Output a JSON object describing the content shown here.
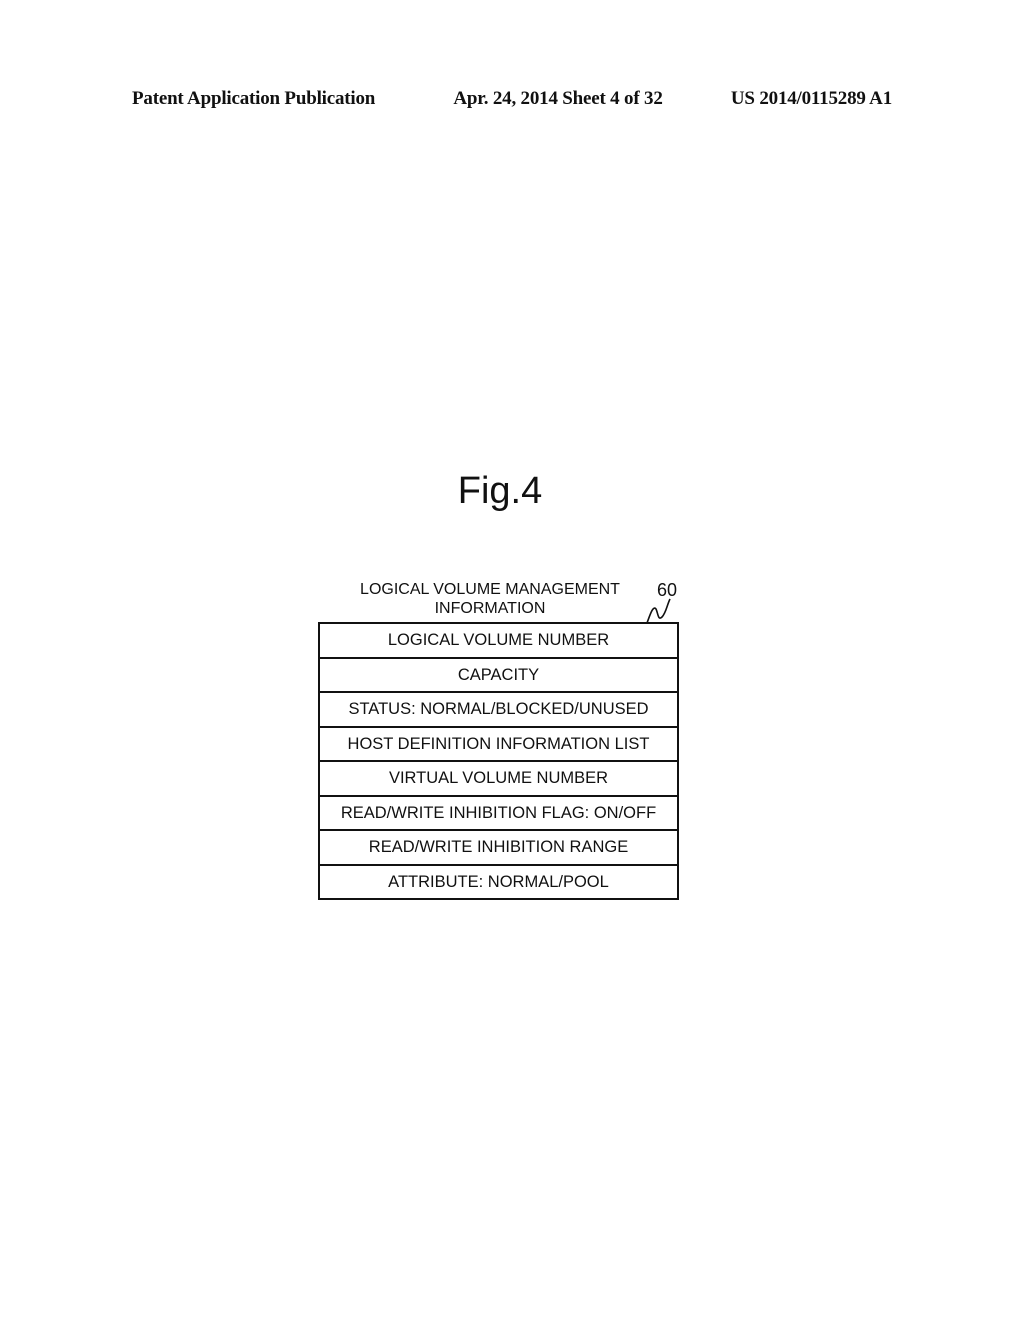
{
  "header": {
    "publication": "Patent Application Publication",
    "date_sheet": "Apr. 24, 2014  Sheet 4 of 32",
    "patent_number": "US 2014/0115289 A1"
  },
  "figure": {
    "title": "Fig.4",
    "caption_line1": "LOGICAL VOLUME MANAGEMENT",
    "caption_line2": "INFORMATION",
    "reference_number": "60",
    "fields": [
      "LOGICAL VOLUME NUMBER",
      "CAPACITY",
      "STATUS: NORMAL/BLOCKED/UNUSED",
      "HOST DEFINITION INFORMATION LIST",
      "VIRTUAL VOLUME NUMBER",
      "READ/WRITE INHIBITION FLAG: ON/OFF",
      "READ/WRITE INHIBITION RANGE",
      "ATTRIBUTE: NORMAL/POOL"
    ]
  }
}
